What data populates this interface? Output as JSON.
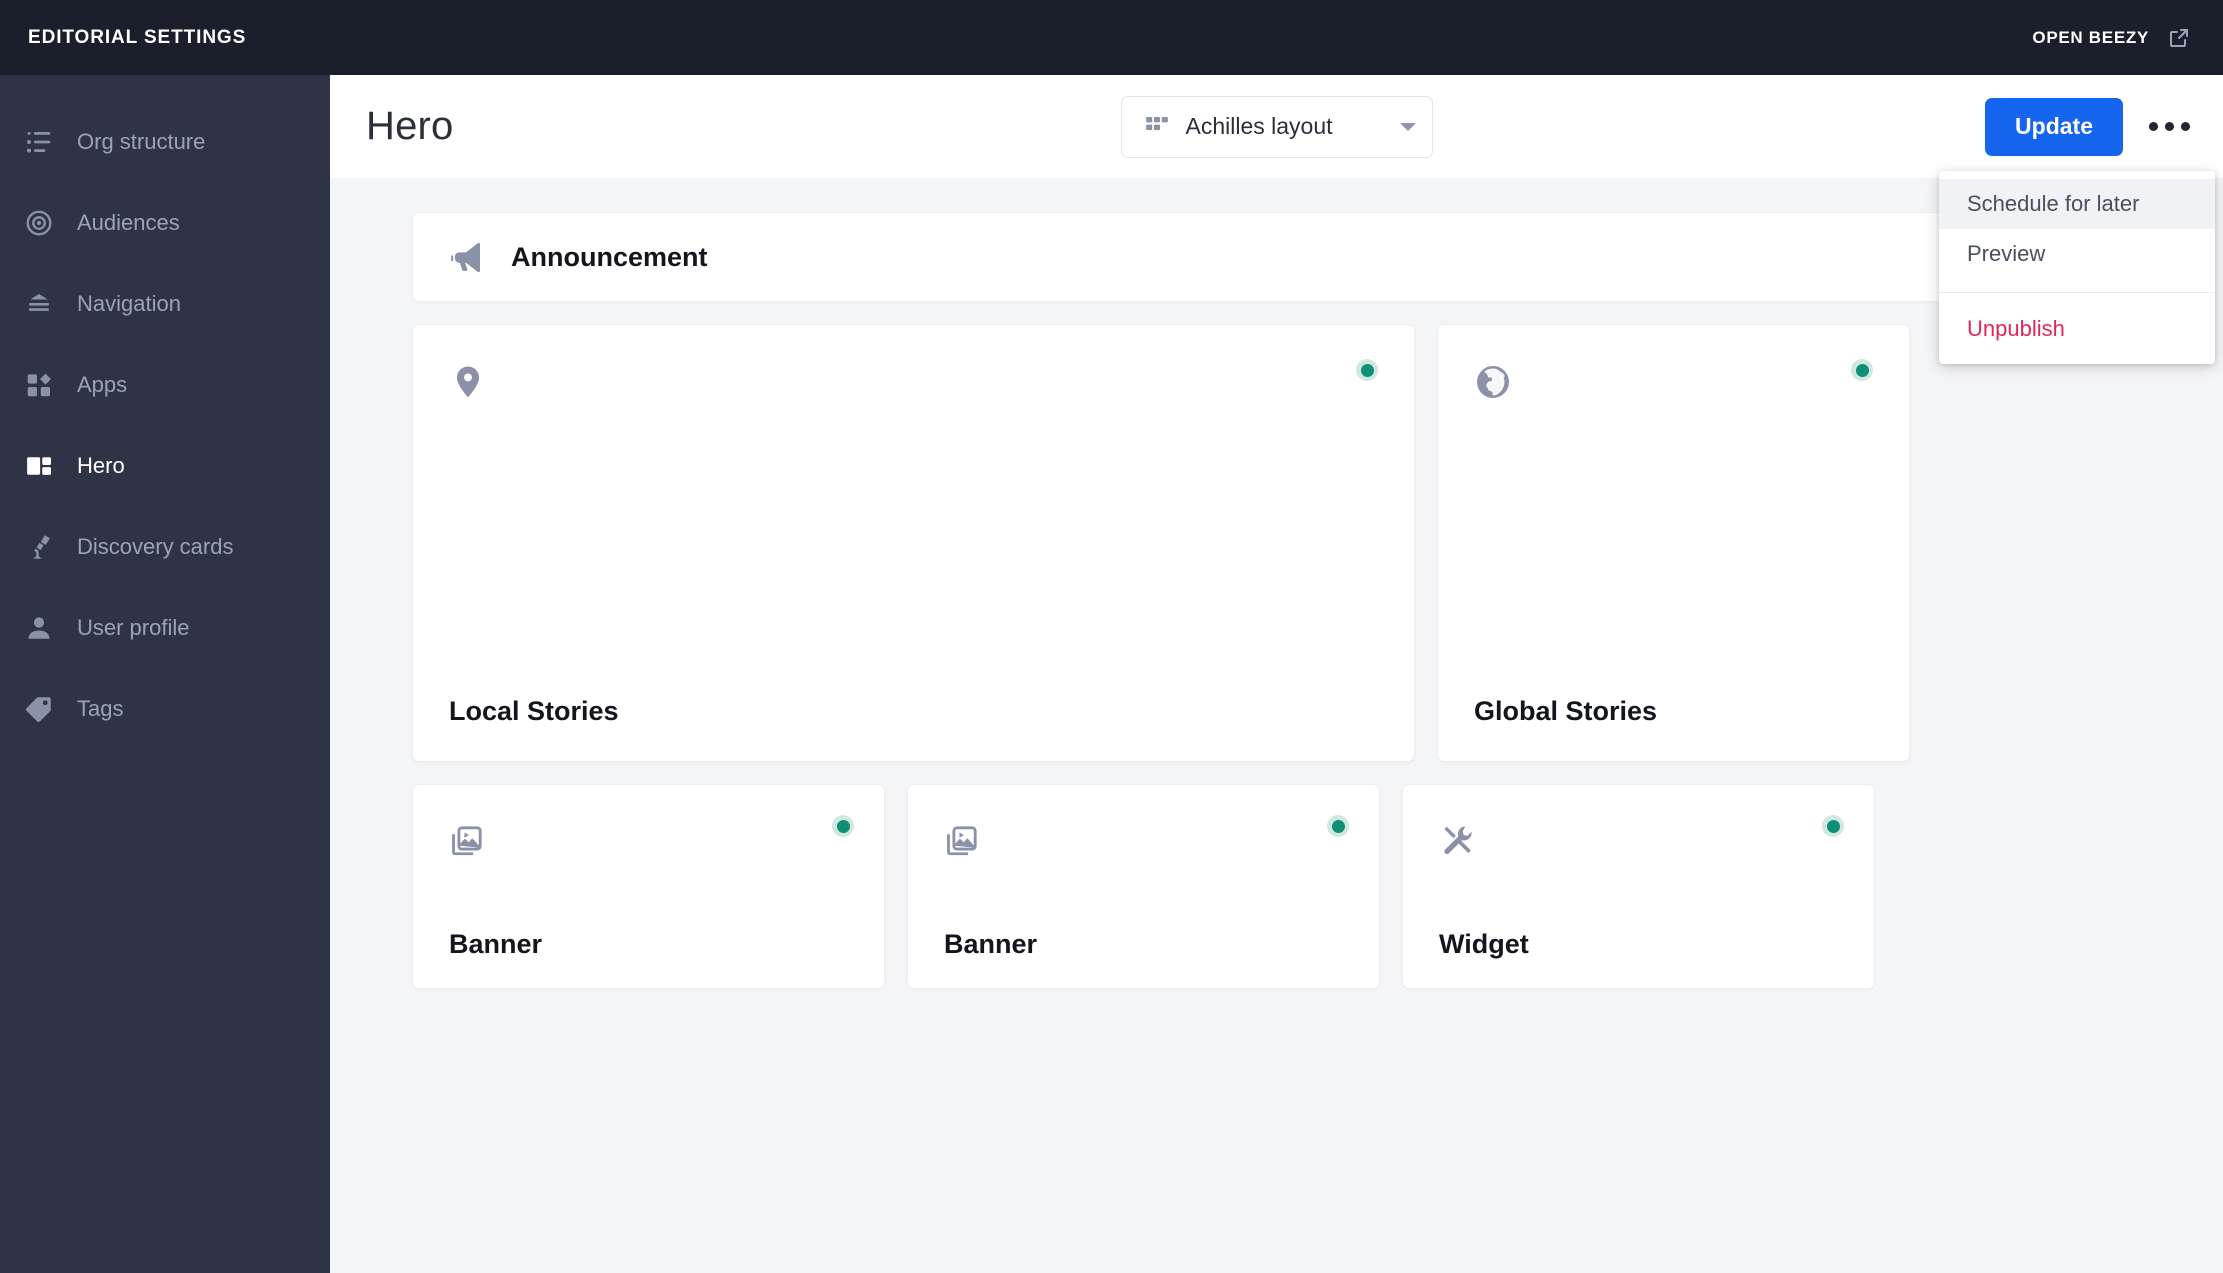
{
  "topbar": {
    "brand": "EDITORIAL SETTINGS",
    "open_link_label": "OPEN BEEZY",
    "external_icon": "external-link-icon"
  },
  "sidebar": {
    "items": [
      {
        "label": "Org structure",
        "icon": "list-icon",
        "active": false
      },
      {
        "label": "Audiences",
        "icon": "target-icon",
        "active": false
      },
      {
        "label": "Navigation",
        "icon": "menu-lines-icon",
        "active": false
      },
      {
        "label": "Apps",
        "icon": "grid-apps-icon",
        "active": false
      },
      {
        "label": "Hero",
        "icon": "layout-icon",
        "active": true
      },
      {
        "label": "Discovery cards",
        "icon": "telescope-icon",
        "active": false
      },
      {
        "label": "User profile",
        "icon": "person-icon",
        "active": false
      },
      {
        "label": "Tags",
        "icon": "tag-icon",
        "active": false
      }
    ]
  },
  "header": {
    "title": "Hero",
    "layout_select": {
      "value": "Achilles layout",
      "icon": "layout-grid-icon"
    },
    "update_label": "Update",
    "more_icon": "kebab-menu-icon"
  },
  "menu": {
    "items": [
      {
        "label": "Schedule for later",
        "style": "default",
        "hovered": true
      },
      {
        "label": "Preview",
        "style": "default",
        "hovered": false
      },
      {
        "label": "Unpublish",
        "style": "danger",
        "hovered": false
      }
    ]
  },
  "content": {
    "announcement": {
      "title": "Announcement",
      "icon": "megaphone-icon"
    },
    "tiles_row1": [
      {
        "title": "Local Stories",
        "icon": "map-pin-icon",
        "status": "published"
      },
      {
        "title": "Global Stories",
        "icon": "globe-icon",
        "status": "published"
      }
    ],
    "tiles_row2": [
      {
        "title": "Banner",
        "icon": "media-image-icon",
        "status": "published"
      },
      {
        "title": "Banner",
        "icon": "media-image-icon",
        "status": "published"
      },
      {
        "title": "Widget",
        "icon": "tools-icon",
        "status": "published"
      }
    ]
  },
  "colors": {
    "topbar_bg": "#1b1e2b",
    "sidebar_bg": "#2e3346",
    "accent_blue": "#1665ef",
    "danger_red": "#e0265c",
    "status_green": "#0e8f76",
    "status_green_halo": "#cfe8e0",
    "canvas_bg": "#f4f5f7"
  }
}
